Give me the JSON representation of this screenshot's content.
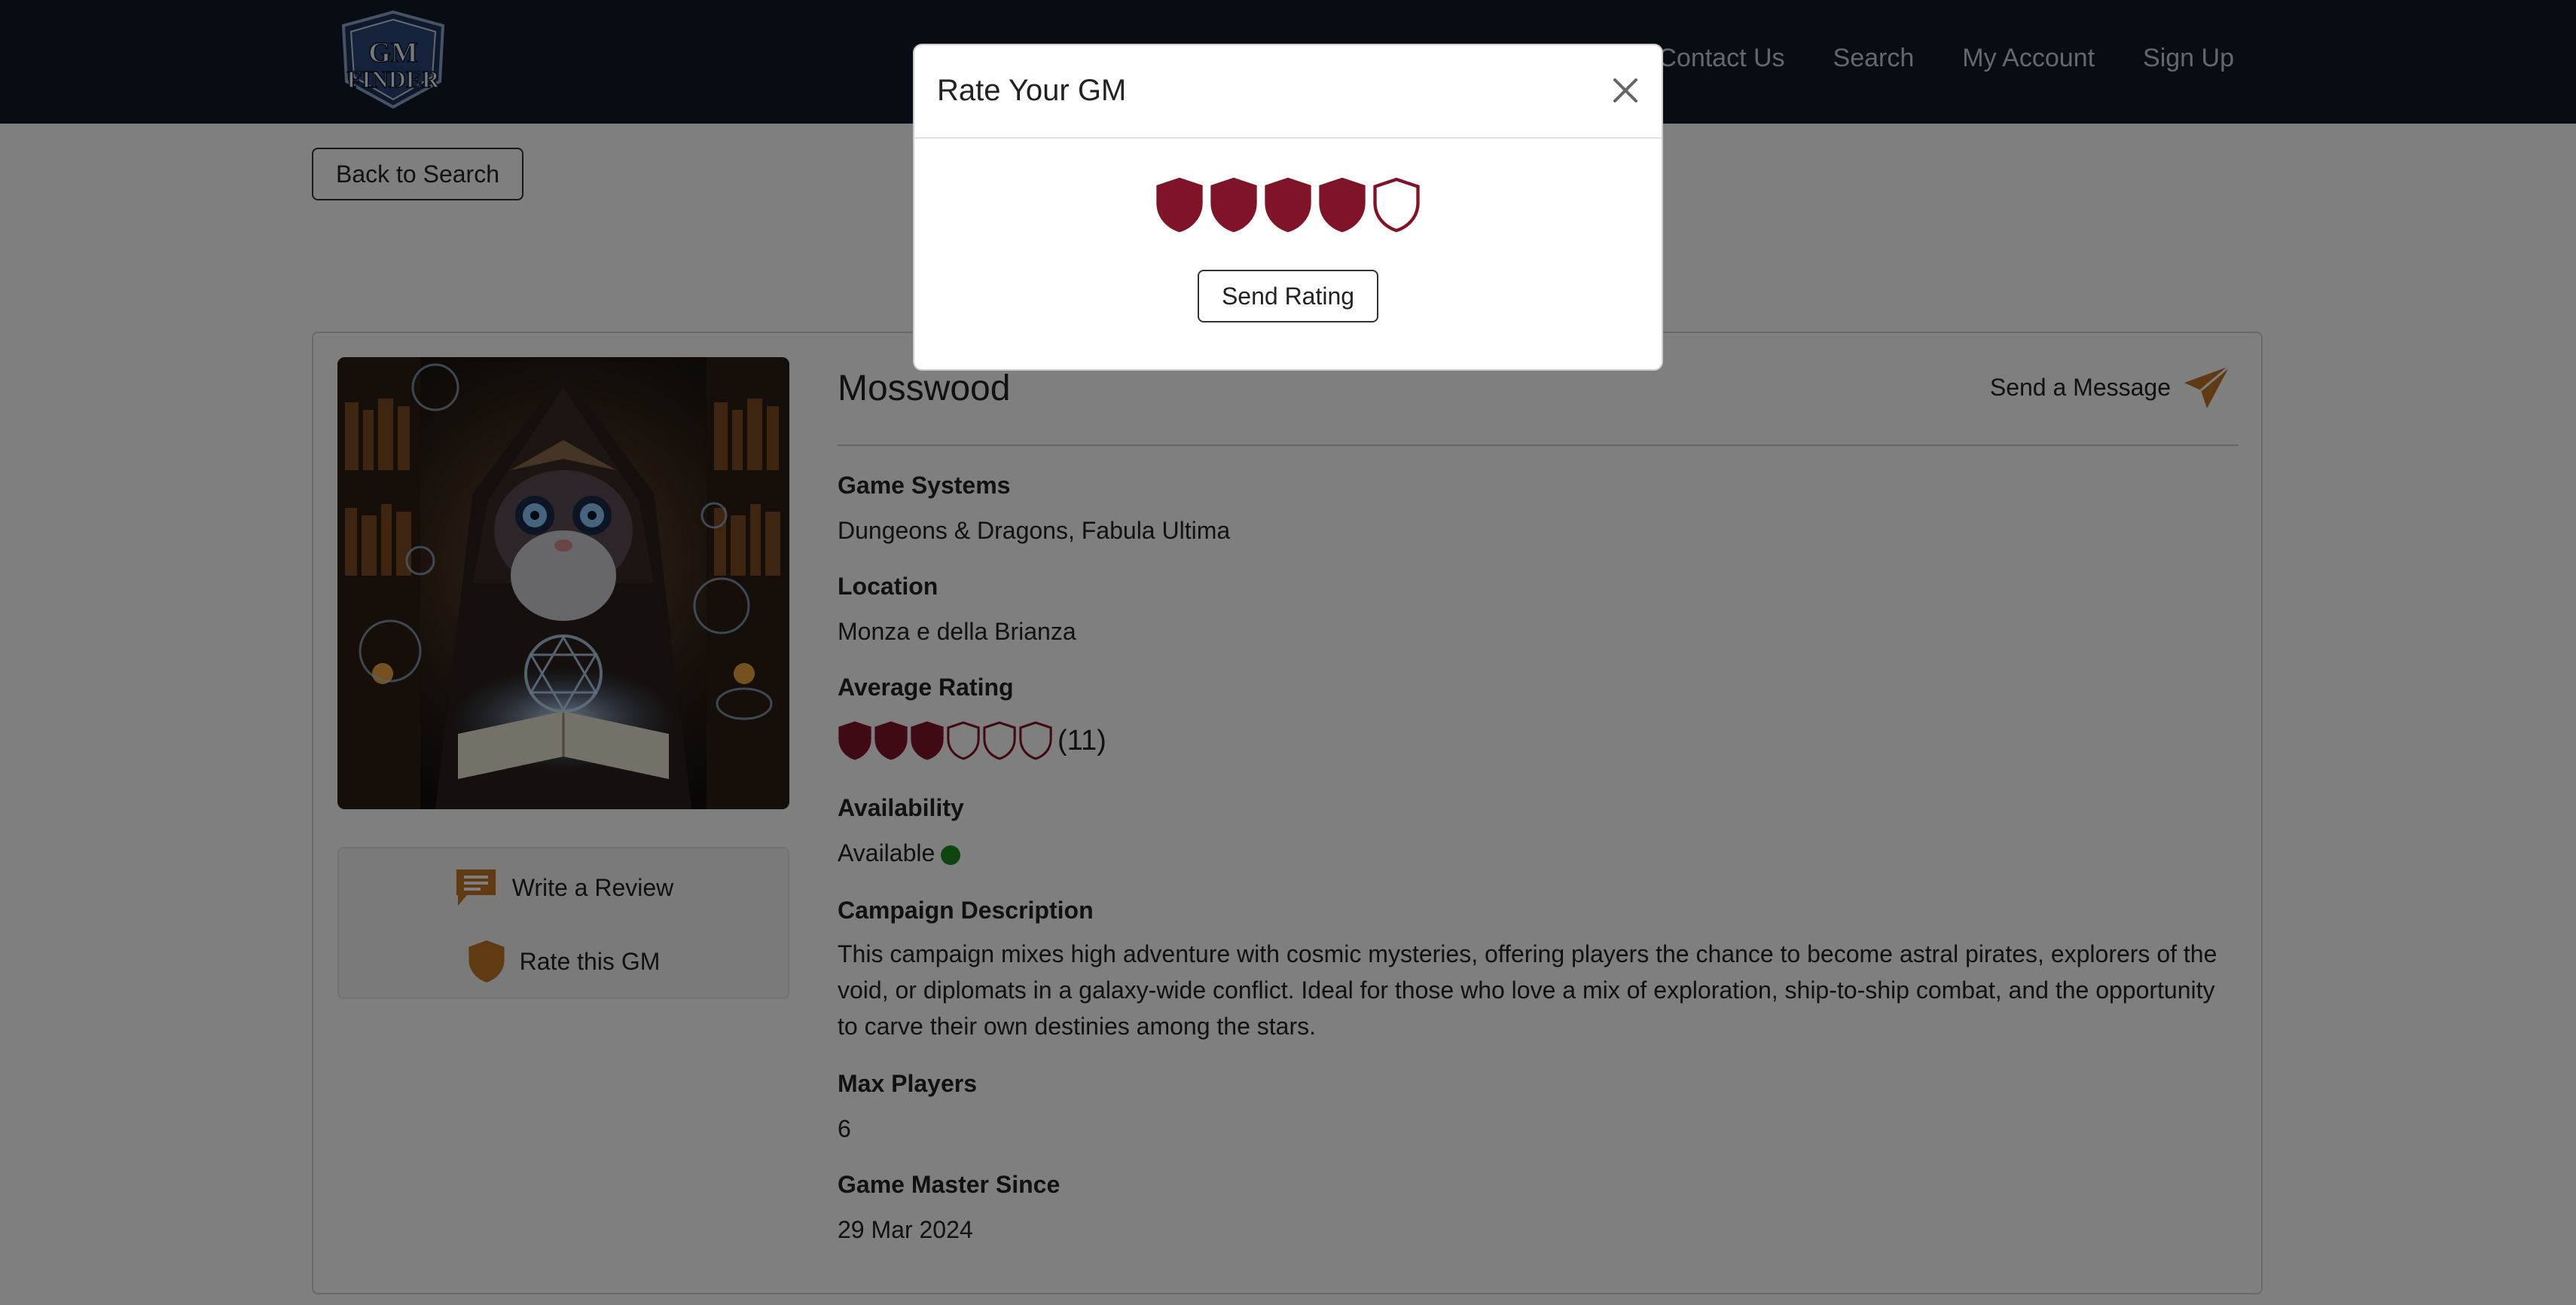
{
  "navbar": {
    "logo_text_top": "GM",
    "logo_text_bottom": "FINDER",
    "links": [
      {
        "label": "Contact Us"
      },
      {
        "label": "Search"
      },
      {
        "label": "My Account"
      },
      {
        "label": "Sign Up"
      }
    ]
  },
  "page": {
    "back_label": "Back to Search"
  },
  "profile": {
    "name": "Mosswood",
    "send_message_label": "Send a Message",
    "write_review_label": "Write a Review",
    "rate_label": "Rate this GM",
    "fields": {
      "game_systems_label": "Game Systems",
      "game_systems_value": "Dungeons & Dragons, Fabula Ultima",
      "location_label": "Location",
      "location_value": "Monza e della Brianza",
      "avg_rating_label": "Average Rating",
      "avg_rating_value": 3,
      "avg_rating_max": 6,
      "avg_rating_count": "(11)",
      "availability_label": "Availability",
      "availability_value": "Available",
      "description_label": "Campaign Description",
      "description_value": "This campaign mixes high adventure with cosmic mysteries, offering players the chance to become astral pirates, explorers of the void, or diplomats in a galaxy-wide conflict. Ideal for those who love a mix of exploration, ship-to-ship combat, and the opportunity to carve their own destinies among the stars.",
      "max_players_label": "Max Players",
      "max_players_value": "6",
      "gm_since_label": "Game Master Since",
      "gm_since_value": "29 Mar 2024"
    }
  },
  "modal": {
    "title": "Rate Your GM",
    "selected_rating": 4,
    "max_rating": 5,
    "submit_label": "Send Rating"
  },
  "colors": {
    "navbar": "#111a29",
    "shield_fill": "#7f1428",
    "accent_orange": "#c07424",
    "available_green": "#1f8a1f"
  },
  "icons": {
    "send": "paper-plane-icon",
    "review": "chat-bubble-icon",
    "rate": "shield-icon",
    "close": "close-icon"
  }
}
